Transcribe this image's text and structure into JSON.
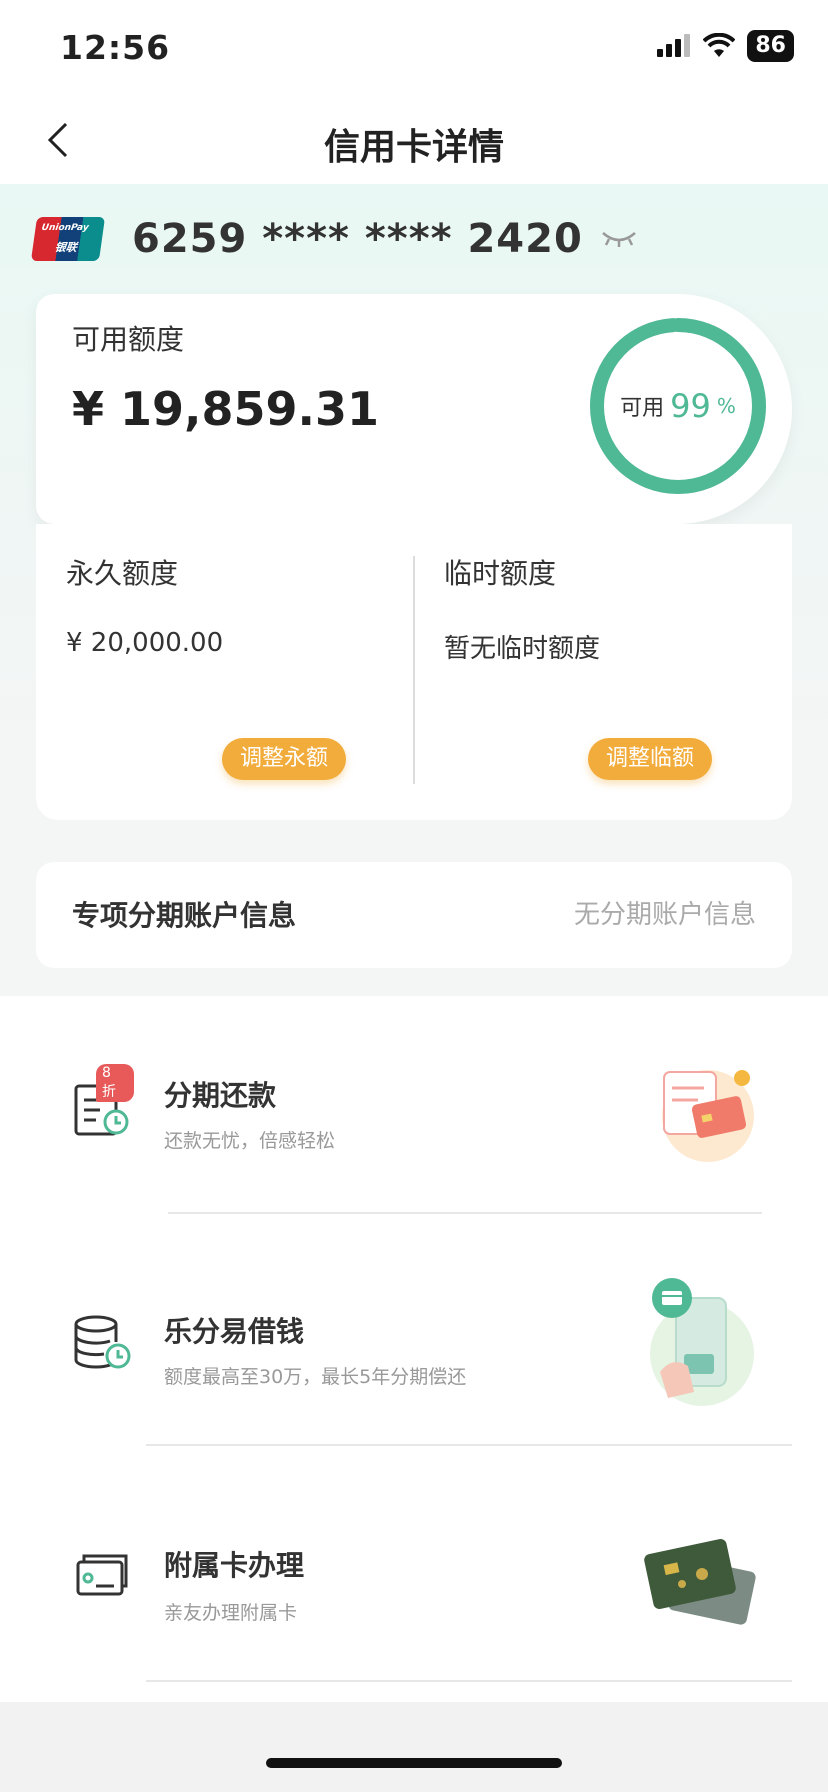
{
  "status_bar": {
    "time": "12:56",
    "battery": "86"
  },
  "nav": {
    "title": "信用卡详情"
  },
  "card": {
    "number": "6259 **** **** 2420",
    "logo_text_en": "UnionPay",
    "logo_text_cn": "银联"
  },
  "available": {
    "label": "可用额度",
    "amount": "¥ 19,859.31",
    "ring_label": "可用",
    "ring_percent": "99",
    "ring_unit": "%",
    "ring_fraction": 0.99
  },
  "limits": {
    "permanent": {
      "title": "永久额度",
      "value": "¥ 20,000.00",
      "button": "调整永额"
    },
    "temporary": {
      "title": "临时额度",
      "value": "暂无临时额度",
      "button": "调整临额"
    }
  },
  "installment_account": {
    "label": "专项分期账户信息",
    "value": "无分期账户信息"
  },
  "services": [
    {
      "title": "分期还款",
      "subtitle": "还款无忧，倍感轻松",
      "badge": "8 折",
      "icon": "installment-repay-icon"
    },
    {
      "title": "乐分易借钱",
      "subtitle": "额度最高至30万，最长5年分期偿还",
      "icon": "loan-coins-icon"
    },
    {
      "title": "附属卡办理",
      "subtitle": "亲友办理附属卡",
      "icon": "supplementary-card-icon"
    }
  ],
  "colors": {
    "accent_green": "#4fb894",
    "button_orange": "#f2ac3c",
    "badge_red": "#e85a5a"
  }
}
